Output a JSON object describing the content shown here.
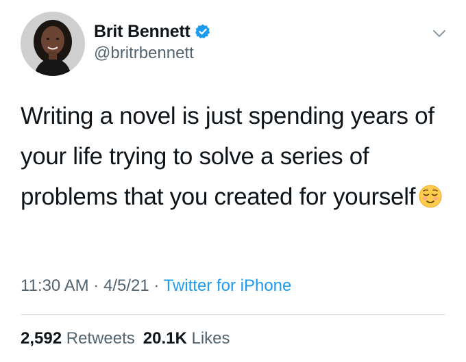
{
  "tweet": {
    "author": {
      "display_name": "Brit Bennett",
      "handle": "@britrbennett",
      "verified": true
    },
    "text": "Writing a novel is just spending years of your life trying to solve a series of problems that you created for yourself",
    "emoji": "relieved-face",
    "meta": {
      "time": "11:30 AM",
      "separator": "·",
      "date": "4/5/21",
      "source": "Twitter for iPhone"
    },
    "stats": {
      "retweets_count": "2,592",
      "retweets_label": "Retweets",
      "likes_count": "20.1K",
      "likes_label": "Likes"
    },
    "colors": {
      "link": "#1d9bf0",
      "secondary_text": "#536471",
      "primary_text": "#0f1419"
    },
    "icons": [
      "verified-badge-icon",
      "chevron-down-icon",
      "relieved-face-emoji"
    ]
  }
}
